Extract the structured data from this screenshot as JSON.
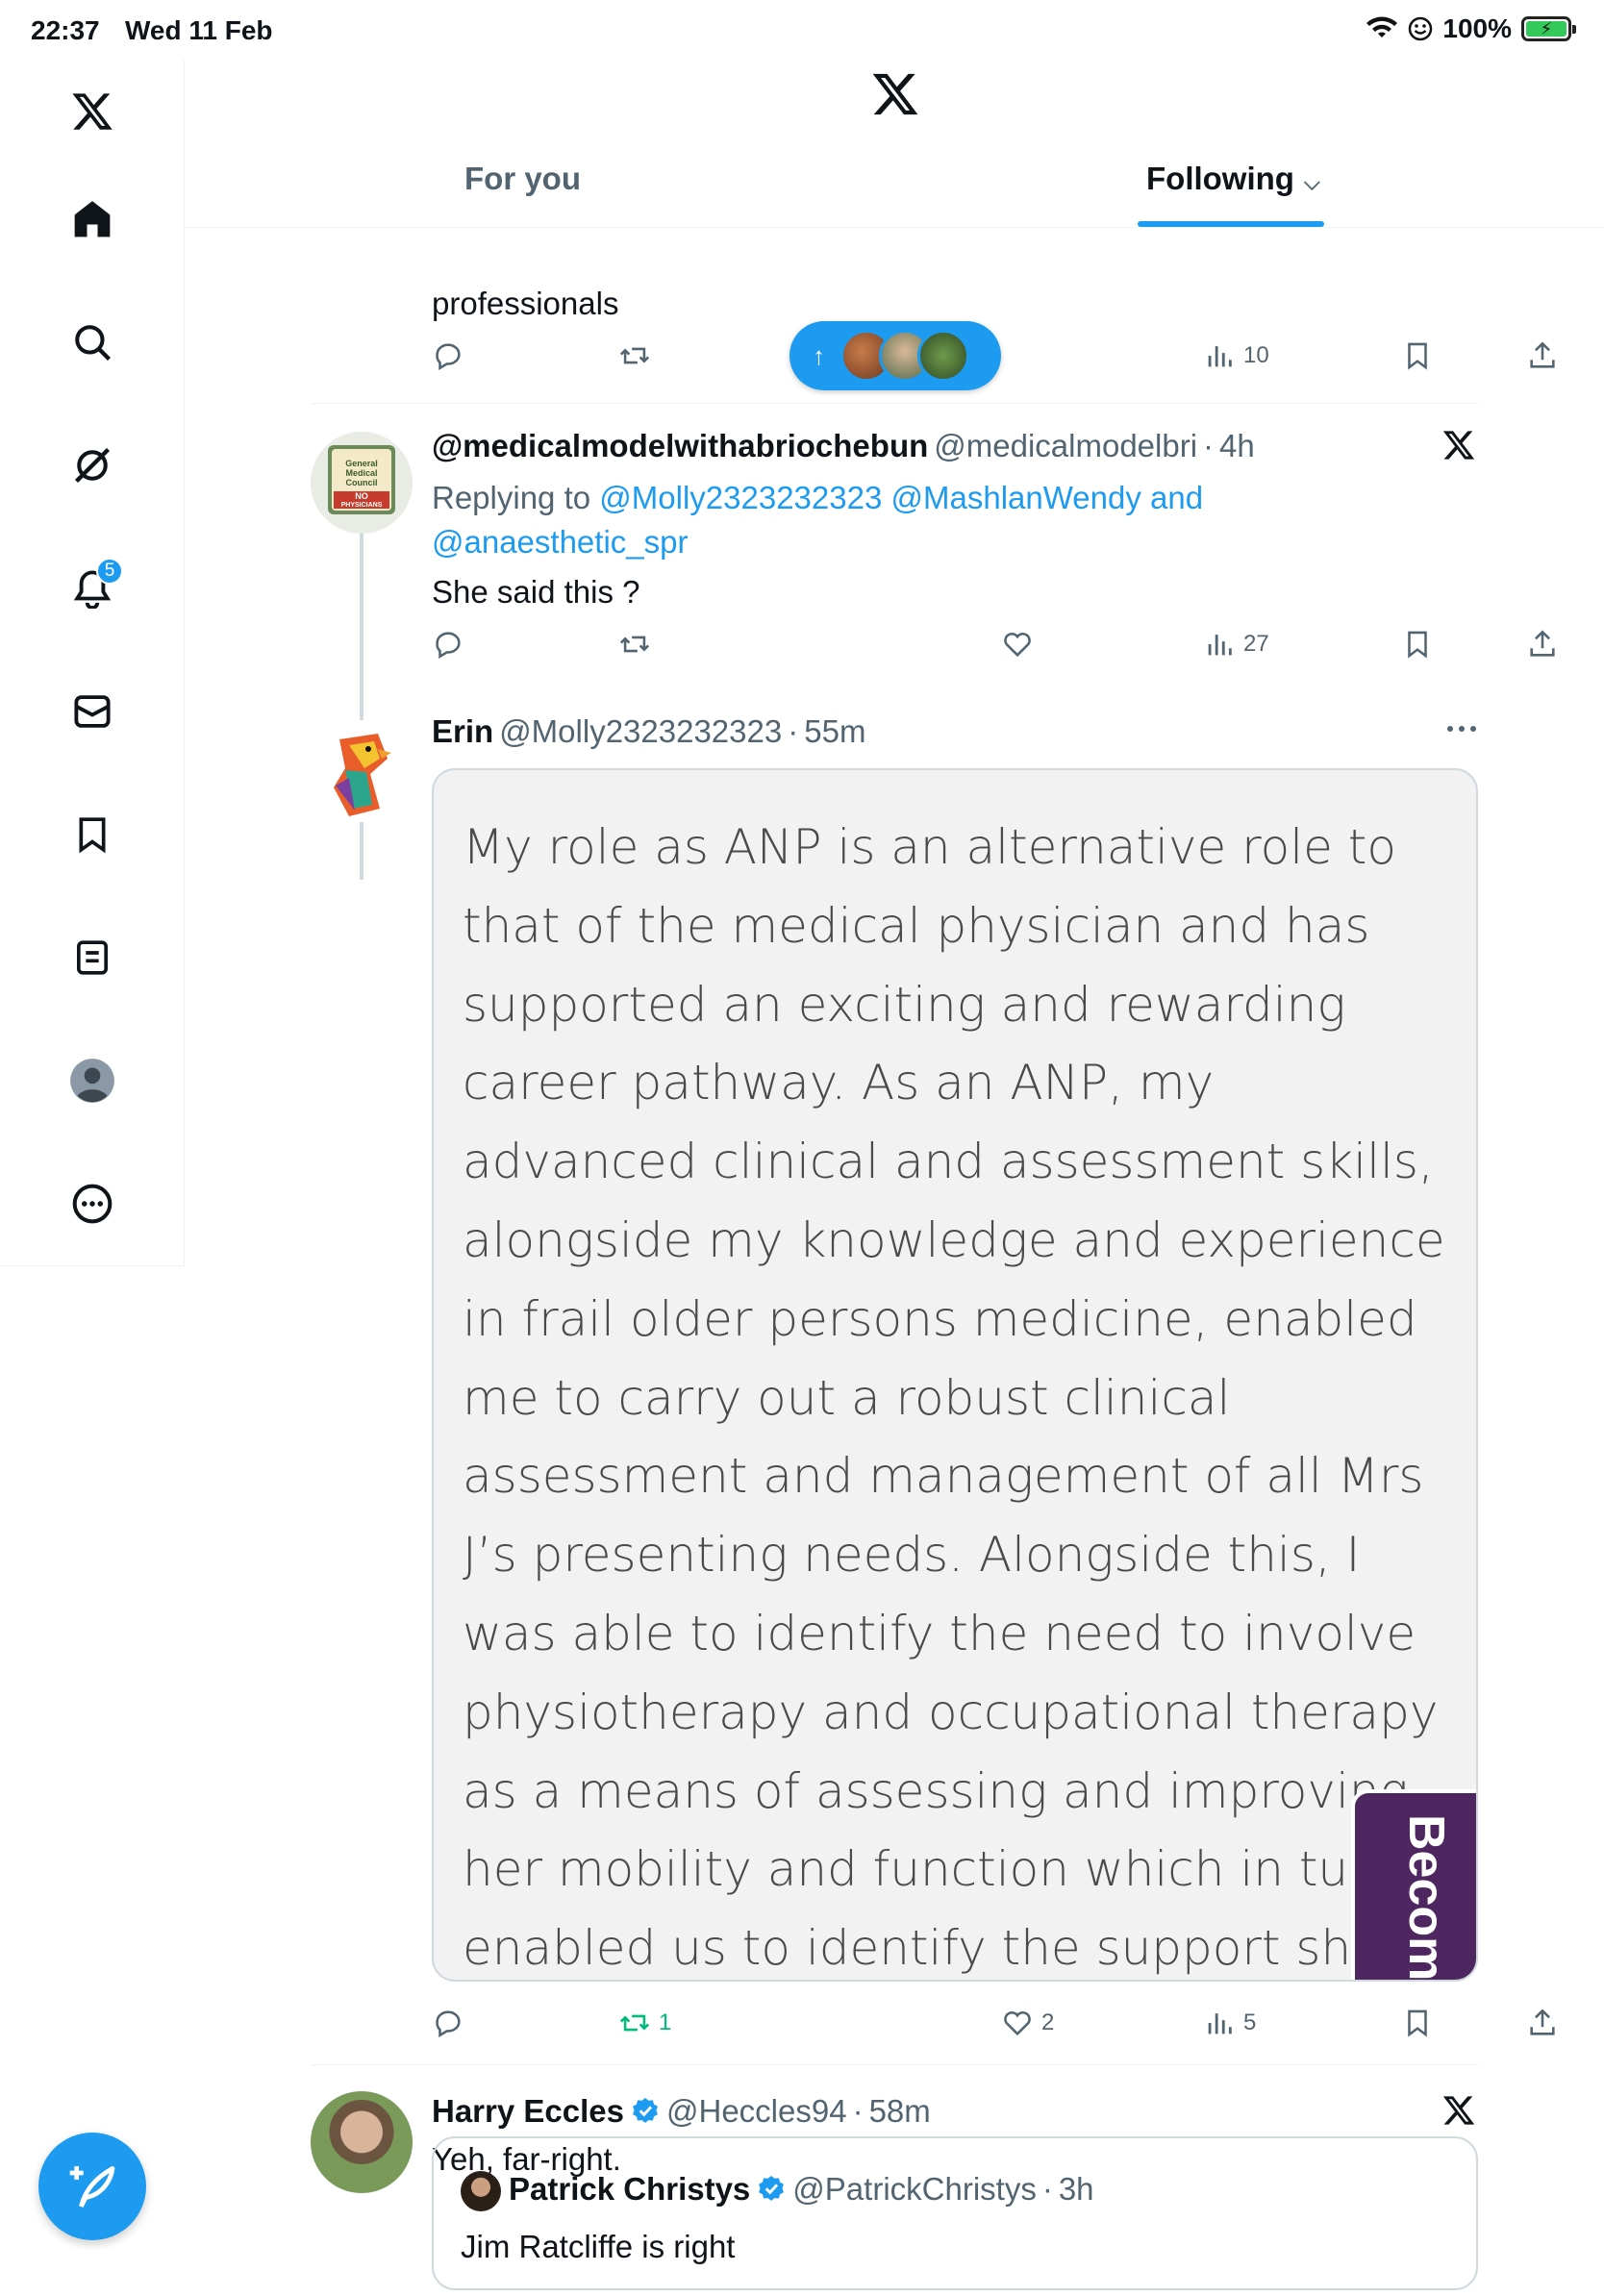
{
  "status_bar": {
    "time": "22:37",
    "date": "Wed 11 Feb",
    "battery": "100%"
  },
  "sidebar": {
    "notification_count": "5"
  },
  "tabs": {
    "for_you": "For you",
    "following": "Following"
  },
  "post0": {
    "text_tail": "professionals",
    "views": "10"
  },
  "post1": {
    "display_name": "@medicalmodelwithabriochebun",
    "handle": "@medicalmodelbri",
    "sep": "·",
    "time": "4h",
    "replying_prefix": "Replying to",
    "mention1": "@Molly2323232323",
    "mention2": "@MashlanWendy",
    "and": "and",
    "mention3": "@anaesthetic_spr",
    "text": "She said this ?",
    "views": "27",
    "avatar_text": [
      "General",
      "Medical",
      "Council",
      "NO",
      "PHYSICIANS"
    ]
  },
  "post2": {
    "display_name": "Erin",
    "handle": "@Molly2323232323",
    "sep": "·",
    "time": "55m",
    "image_text": "My role as ANP is an alternative role to that of the medical physician and has supported an exciting and rewarding career pathway. As an ANP, my advanced clinical and assessment skills, alongside my knowledge and experience in frail older persons medicine, enabled me to carry out a robust clinical assessment and management of all Mrs J’s presenting needs. Alongside this, I was able to identify the need to involve physiotherapy and occupational therapy as a means of assessing and improving her mobility and function which in turn, enabled us to identify the support she required to return to her own home.",
    "overlay_label": "Becom",
    "retweets": "1",
    "likes": "2",
    "views": "5"
  },
  "post3": {
    "display_name": "Harry Eccles",
    "handle": "@Heccles94",
    "sep": "·",
    "time": "58m",
    "text": "Yeh, far-right.",
    "quote": {
      "display_name": "Patrick Christys",
      "handle": "@PatrickChristys",
      "sep": "·",
      "time": "3h",
      "text": "Jim Ratcliffe is right"
    }
  },
  "colors": {
    "accent": "#1d9bf0",
    "retweet_active": "#00ba7c",
    "secondary_text": "#536471",
    "overlay": "#4f2760"
  },
  "icons": [
    "x-logo-icon",
    "home-icon",
    "search-icon",
    "grok-icon",
    "bell-icon",
    "mail-icon",
    "bookmark-icon",
    "lists-icon",
    "profile-icon",
    "more-icon",
    "compose-icon",
    "reply-icon",
    "retweet-icon",
    "like-icon",
    "views-icon",
    "share-icon",
    "more-horizontal-icon",
    "verified-icon"
  ]
}
